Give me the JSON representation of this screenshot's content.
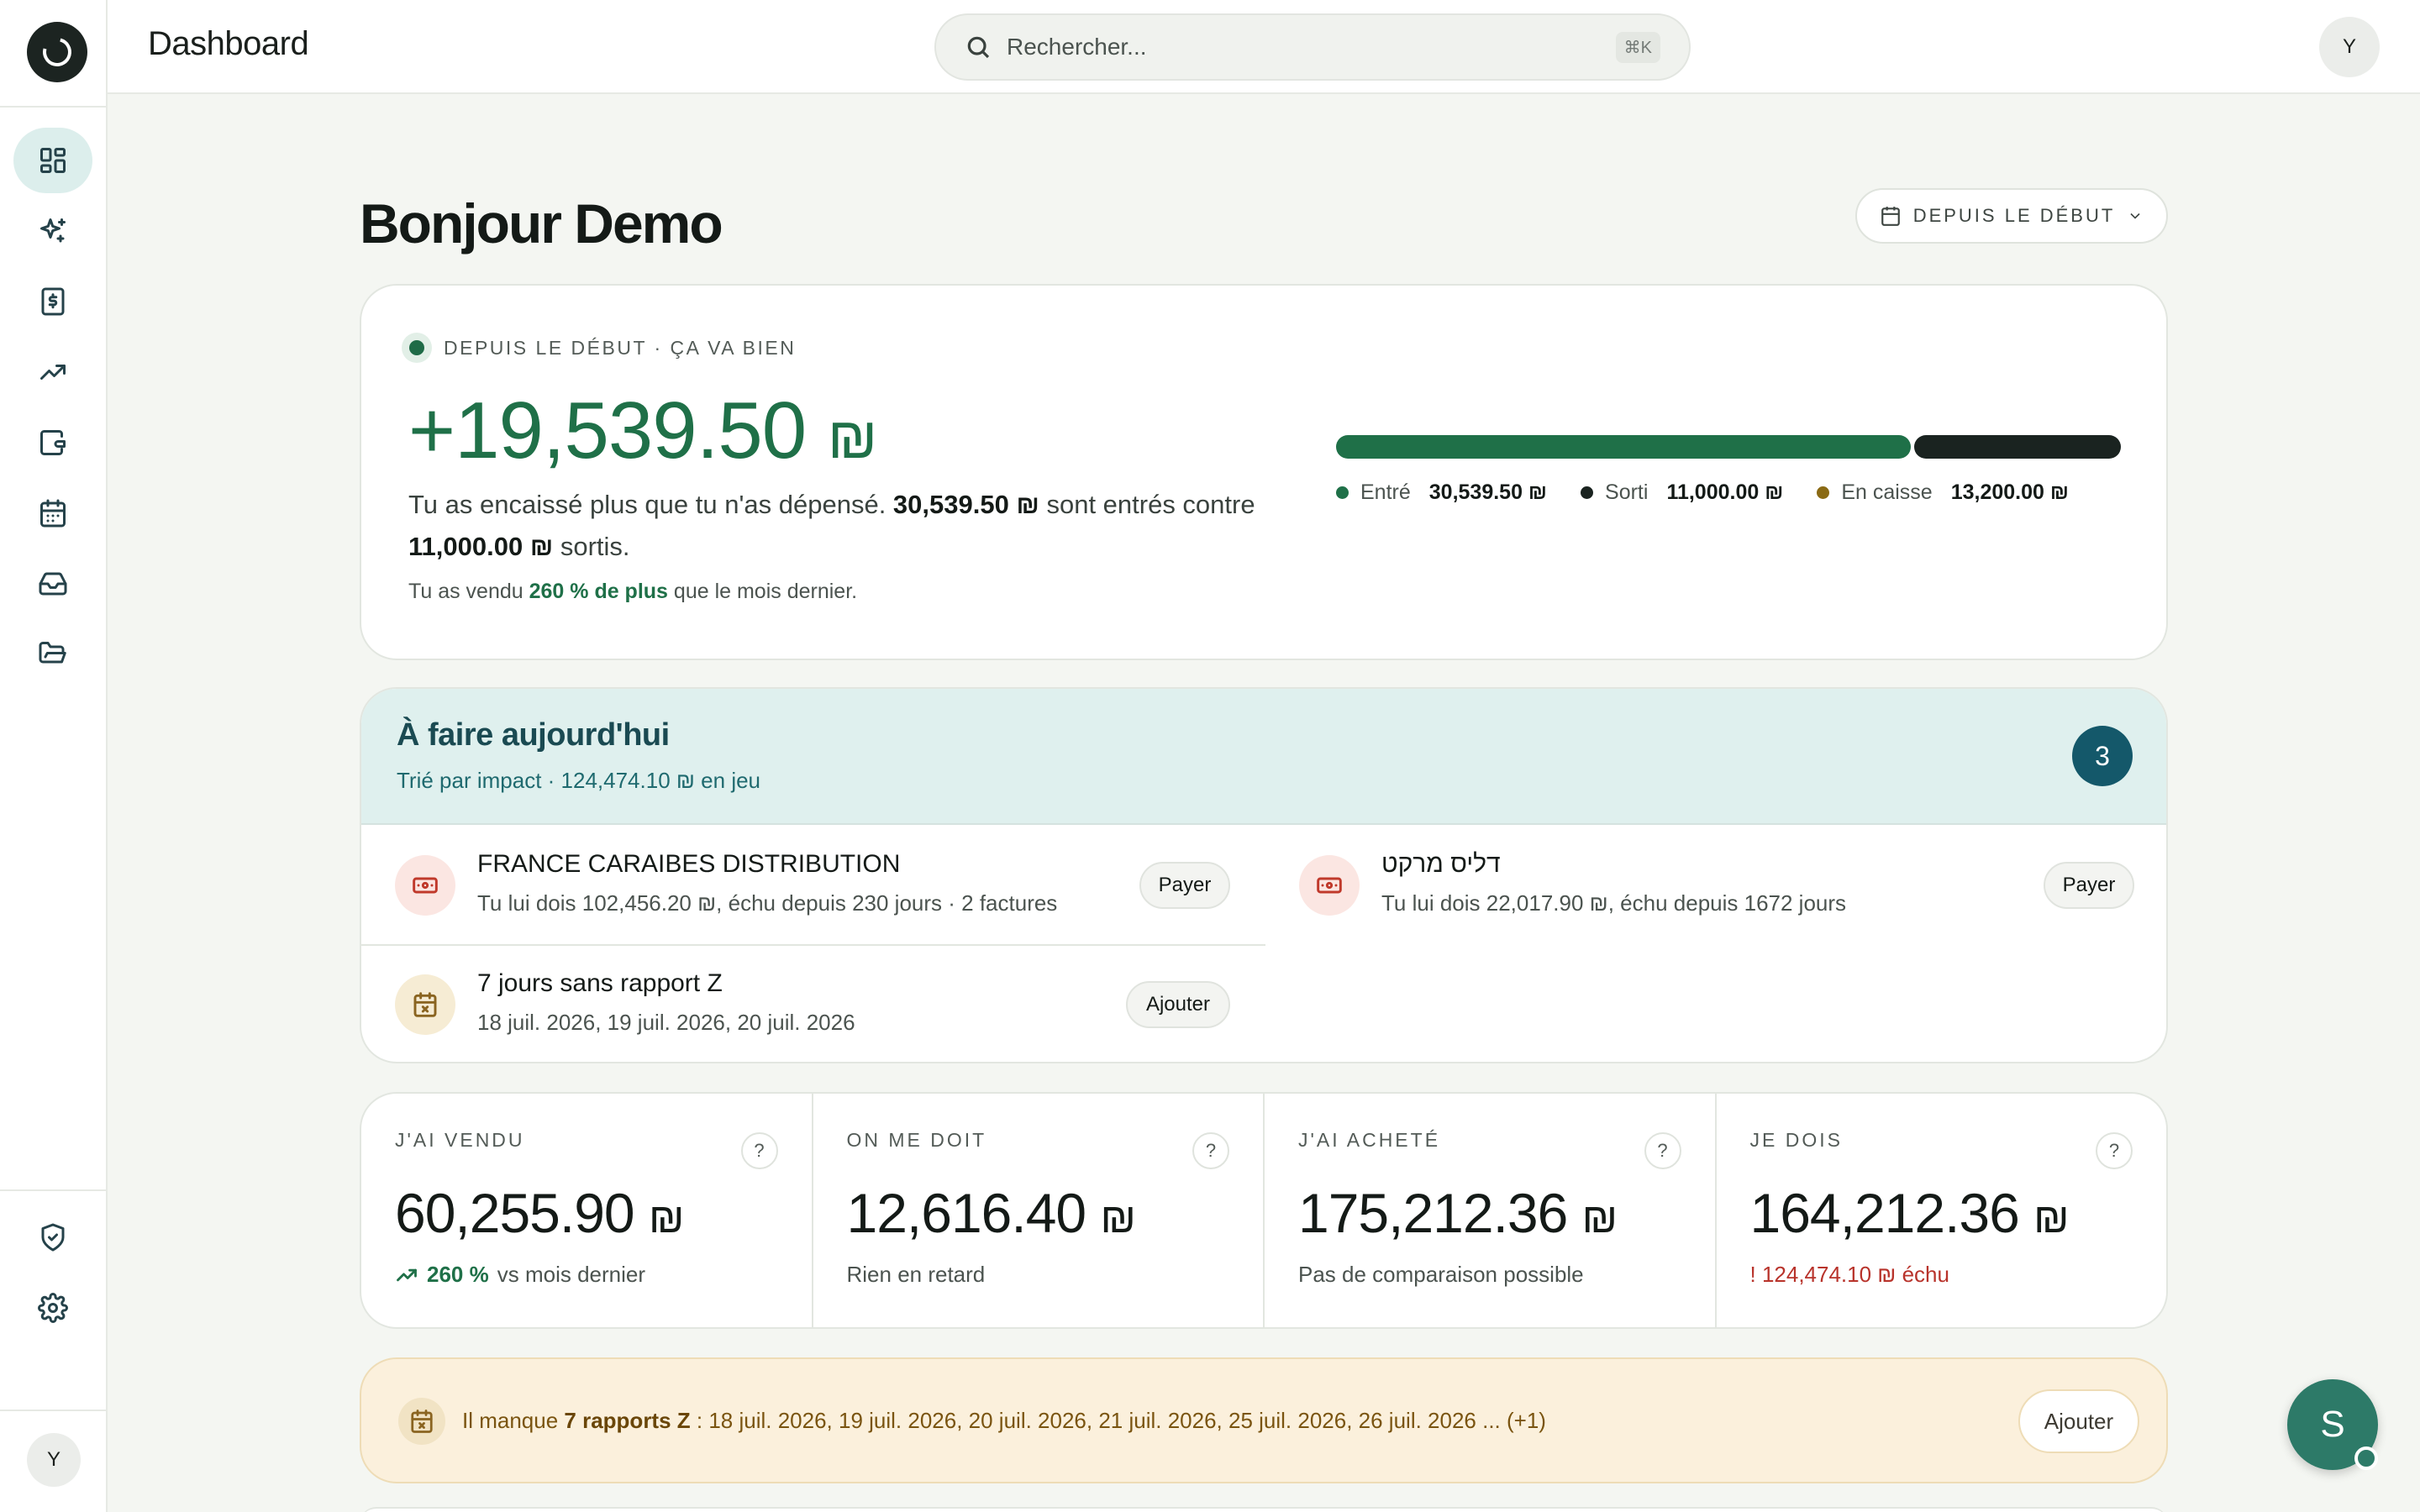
{
  "topbar": {
    "title": "Dashboard",
    "search_placeholder": "Rechercher...",
    "search_shortcut": "⌘K",
    "avatar_initial": "Y"
  },
  "sidebar": {
    "items": [
      {
        "icon": "dashboard-icon",
        "active": true
      },
      {
        "icon": "sparkles-icon"
      },
      {
        "icon": "invoice-icon"
      },
      {
        "icon": "trending-up-icon"
      },
      {
        "icon": "wallet-icon"
      },
      {
        "icon": "calendar-icon"
      },
      {
        "icon": "inbox-icon"
      },
      {
        "icon": "folder-icon"
      }
    ],
    "bottom_items": [
      {
        "icon": "shield-check-icon"
      },
      {
        "icon": "gear-icon"
      }
    ],
    "avatar_initial": "Y"
  },
  "header": {
    "greeting": "Bonjour Demo",
    "period_label": "DEPUIS LE DÉBUT"
  },
  "summary": {
    "status": "DEPUIS LE DÉBUT · ÇA VA BIEN",
    "net_amount": "+19,539.50",
    "currency": "₪",
    "text_before": "Tu as encaissé plus que tu n'as dépensé. ",
    "in_amount": "30,539.50 ₪",
    "text_middle": " sont entrés contre ",
    "out_amount": "11,000.00 ₪",
    "text_after": " sortis.",
    "sub_before": "Tu as vendu ",
    "sub_highlight": "260 % de plus",
    "sub_after": " que le mois dernier.",
    "bar": [
      {
        "label": "Entré",
        "value": "30,539.50 ₪",
        "amount": 30539.5,
        "color": "#1f7048"
      },
      {
        "label": "Sorti",
        "value": "11,000.00 ₪",
        "amount": 11000.0,
        "color": "#1a2320"
      },
      {
        "label": "En caisse",
        "value": "13,200.00 ₪",
        "amount": 13200.0,
        "color": "#8a6a14"
      }
    ]
  },
  "todo": {
    "title": "À faire aujourd'hui",
    "subtitle": "Trié par impact · 124,474.10 ₪ en jeu",
    "count": "3",
    "items": [
      {
        "title": "FRANCE CARAIBES DISTRIBUTION",
        "detail": "Tu lui dois 102,456.20 ₪, échu depuis 230 jours · 2 factures",
        "action": "Payer",
        "icon": "banknote-icon"
      },
      {
        "title": "דליס מרקט",
        "detail": "Tu lui dois 22,017.90 ₪, échu depuis 1672 jours",
        "action": "Payer",
        "icon": "banknote-icon"
      },
      {
        "title": "7 jours sans rapport Z",
        "detail": "18 juil. 2026, 19 juil. 2026, 20 juil. 2026",
        "action": "Ajouter",
        "icon": "calendar-x-icon"
      }
    ]
  },
  "stats": [
    {
      "label": "J'AI VENDU",
      "value": "60,255.90",
      "currency": "₪",
      "note_highlight": "260 %",
      "note": "vs mois dernier",
      "note_type": "trend"
    },
    {
      "label": "ON ME DOIT",
      "value": "12,616.40",
      "currency": "₪",
      "note": "Rien en retard",
      "note_type": "plain"
    },
    {
      "label": "J'AI ACHETÉ",
      "value": "175,212.36",
      "currency": "₪",
      "note": "Pas de comparaison possible",
      "note_type": "plain"
    },
    {
      "label": "JE DOIS",
      "value": "164,212.36",
      "currency": "₪",
      "note": "! 124,474.10 ₪ échu",
      "note_type": "alert"
    }
  ],
  "stat_help": "?",
  "alert": {
    "before": "Il manque ",
    "highlight": "7 rapports Z",
    "after": " : 18 juil. 2026, 19 juil. 2026, 20 juil. 2026, 21 juil. 2026, 25 juil. 2026, 26 juil. 2026 ... (+1)",
    "action": "Ajouter"
  },
  "floating_avatar_initial": "S"
}
